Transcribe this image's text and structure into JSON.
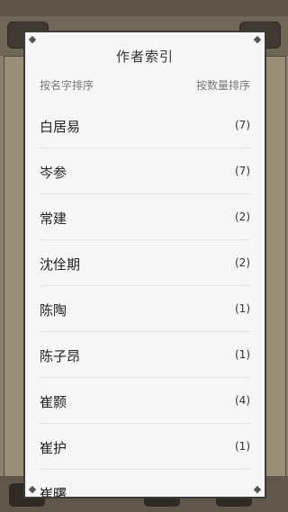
{
  "dialog": {
    "title": "作者索引",
    "sort_by_name": "按名字排序",
    "sort_by_count": "按数量排序"
  },
  "authors": [
    {
      "name": "白居易",
      "count": "(7)"
    },
    {
      "name": "岑参",
      "count": "(7)"
    },
    {
      "name": "常建",
      "count": "(2)"
    },
    {
      "name": "沈佺期",
      "count": "(2)"
    },
    {
      "name": "陈陶",
      "count": "(1)"
    },
    {
      "name": "陈子昂",
      "count": "(1)"
    },
    {
      "name": "崔颢",
      "count": "(4)"
    },
    {
      "name": "崔护",
      "count": "(1)"
    },
    {
      "name": "崔曙",
      "count": ""
    }
  ]
}
